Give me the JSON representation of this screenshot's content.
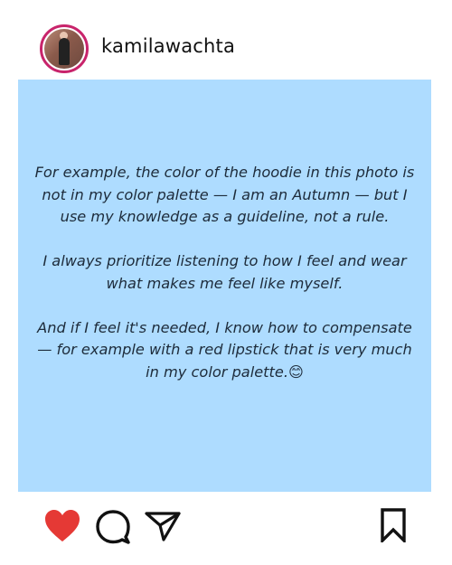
{
  "header": {
    "username": "kamilawachta",
    "avatar_icon": "profile-photo"
  },
  "post": {
    "background_color": "#aedcff",
    "paragraphs": [
      "For example, the color of the hoodie in this photo is not in my color palette — I am an Autumn — but I use my knowledge as a guideline, not a rule.",
      "I always prioritize listening to how I feel and wear what makes me feel like myself.",
      "And if I feel it's needed, I know how to compensate — for example with a red lipstick that is very much in my color palette.😊"
    ]
  },
  "actions": {
    "like_icon": "heart-icon",
    "comment_icon": "comment-bubble-icon",
    "share_icon": "paper-plane-icon",
    "save_icon": "bookmark-icon",
    "like_color": "#e53935"
  }
}
